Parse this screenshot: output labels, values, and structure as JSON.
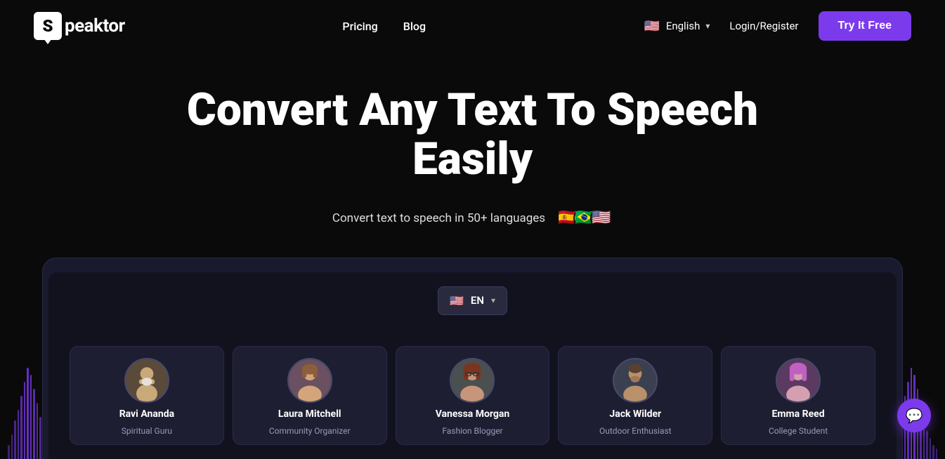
{
  "brand": {
    "logo_letter": "S",
    "name_rest": "peaktor"
  },
  "navbar": {
    "links": [
      {
        "id": "pricing",
        "label": "Pricing"
      },
      {
        "id": "blog",
        "label": "Blog"
      }
    ],
    "language": {
      "flag": "🇺🇸",
      "label": "English",
      "chevron": "▾"
    },
    "login_label": "Login/Register",
    "cta_label": "Try It Free"
  },
  "hero": {
    "title": "Convert Any Text To Speech Easily",
    "subtitle": "Convert text to speech in 50+ languages",
    "flags": [
      "🇪🇸",
      "🇧🇷",
      "🇺🇸"
    ]
  },
  "demo": {
    "language_selector": {
      "flag": "🇺🇸",
      "code": "EN",
      "chevron": "▾"
    },
    "voice_cards": [
      {
        "id": "ravi",
        "name": "Ravi Ananda",
        "role": "Spiritual Guru",
        "avatar_color": "#5a4a3a",
        "avatar_emoji": "🧙"
      },
      {
        "id": "laura",
        "name": "Laura Mitchell",
        "role": "Community Organizer",
        "avatar_color": "#4a3a4a",
        "avatar_emoji": "👩"
      },
      {
        "id": "vanessa",
        "name": "Vanessa Morgan",
        "role": "Fashion Blogger",
        "avatar_color": "#3a4a4a",
        "avatar_emoji": "👩‍🦰"
      },
      {
        "id": "jack",
        "name": "Jack Wilder",
        "role": "Outdoor Enthusiast",
        "avatar_color": "#3a3a5a",
        "avatar_emoji": "👨"
      },
      {
        "id": "emma",
        "name": "Emma Reed",
        "role": "College Student",
        "avatar_color": "#4a3a5a",
        "avatar_emoji": "👩‍🦱"
      }
    ]
  },
  "chat": {
    "icon": "💬"
  },
  "colors": {
    "accent": "#7c3aed",
    "bg_dark": "#0a0a0a",
    "bg_device": "#1a1a2e",
    "wave_color": "#7c3aed"
  }
}
